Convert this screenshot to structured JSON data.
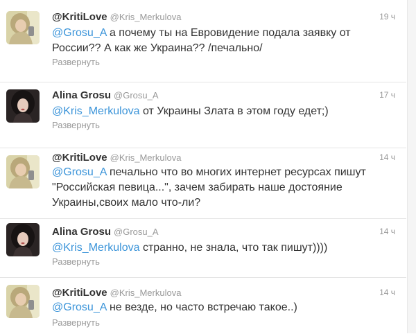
{
  "tweets": [
    {
      "author_name": "@KritiLove",
      "author_handle": "@Kris_Merkulova",
      "time": "19 ч",
      "mention": "@Grosu_A",
      "text": " а почему ты на Евровидение подала заявку от России?? А как же Украина?? /печально/",
      "expand": "Развернуть",
      "avatar": "kriti-avatar"
    },
    {
      "author_name": "Alina Grosu",
      "author_handle": "@Grosu_A",
      "time": "17 ч",
      "mention": "@Kris_Merkulova",
      "text": " от Украины Злата в этом году едет;)",
      "expand": "Развернуть",
      "avatar": "alina-avatar"
    },
    {
      "author_name": "@KritiLove",
      "author_handle": "@Kris_Merkulova",
      "time": "14 ч",
      "mention": "@Grosu_A",
      "text": " печально что во многих интернет ресурсах пишут \"Российская певица...\", зачем забирать наше достояние Украины,своих мало что-ли?",
      "expand": "Развернуть",
      "avatar": "kriti-avatar"
    },
    {
      "author_name": "Alina Grosu",
      "author_handle": "@Grosu_A",
      "time": "14 ч",
      "mention": "@Kris_Merkulova",
      "text": " странно, не знала, что так пишут))))",
      "expand": "Развернуть",
      "avatar": "alina-avatar"
    },
    {
      "author_name": "@KritiLove",
      "author_handle": "@Kris_Merkulova",
      "time": "14 ч",
      "mention": "@Grosu_A",
      "text": " не везде, но часто встречаю такое..)",
      "expand": "Развернуть",
      "avatar": "kriti-avatar"
    }
  ],
  "colors": {
    "mention": "#3b94d9",
    "muted": "#999999",
    "text": "#333333",
    "divider": "#e4e4e4"
  }
}
